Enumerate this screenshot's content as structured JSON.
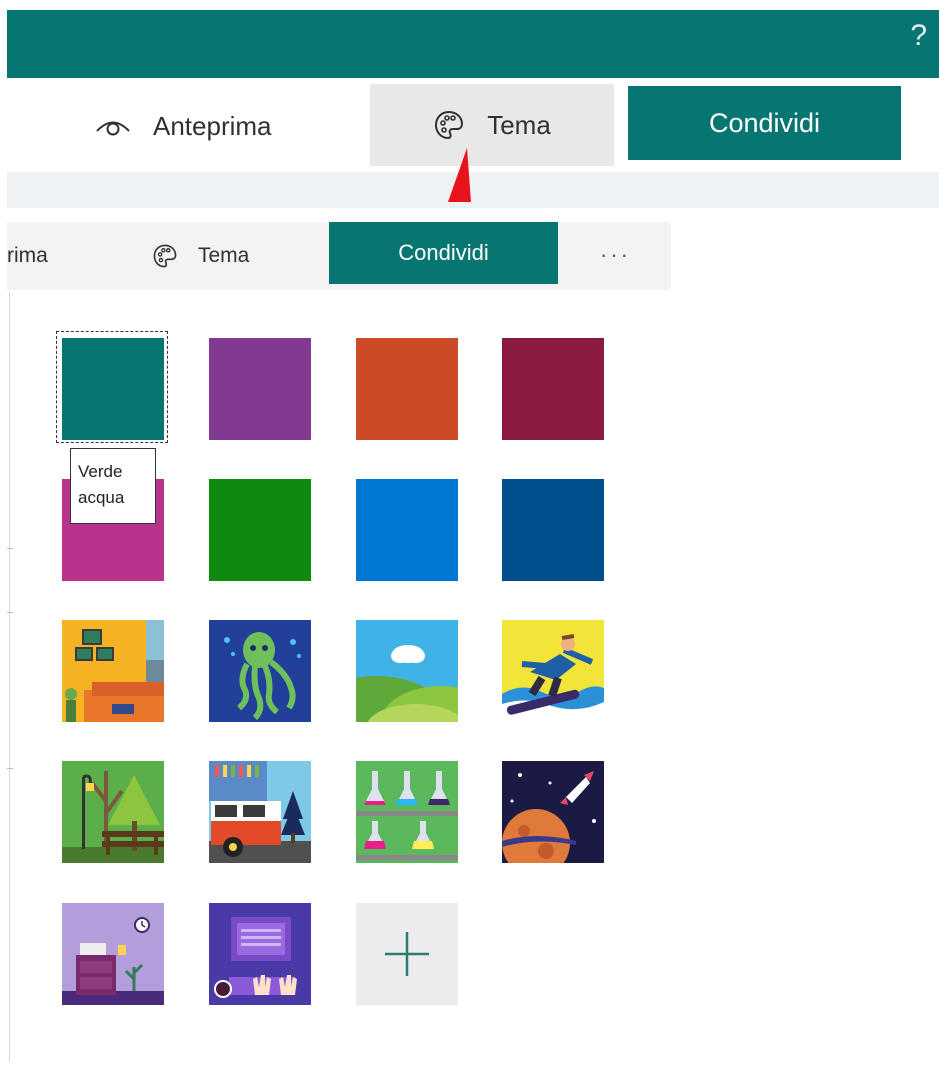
{
  "header": {
    "help_label": "?"
  },
  "zoomed_toolbar": {
    "preview_label": "Anteprima",
    "theme_label": "Tema",
    "share_label": "Condividi"
  },
  "toolbar": {
    "preview_label": "rima",
    "theme_label": "Tema",
    "share_label": "Condividi",
    "more_label": "···"
  },
  "themes": {
    "tooltip": [
      "Verde",
      "acqua"
    ],
    "colors": [
      "#077672",
      "#813a8f",
      "#ca4b25",
      "#8a1a40",
      "#b8348c",
      "#0f8a0f",
      "#0078d4",
      "#004e8c"
    ],
    "image_themes": [
      "living-room-theme",
      "octopus-theme",
      "landscape-theme",
      "snowboard-theme",
      "park-theme",
      "van-theme",
      "science-theme",
      "space-theme",
      "desk-theme",
      "computer-theme"
    ],
    "add_label": "+"
  },
  "colors": {
    "accent": "#077672",
    "arrow": "#e8141c"
  }
}
